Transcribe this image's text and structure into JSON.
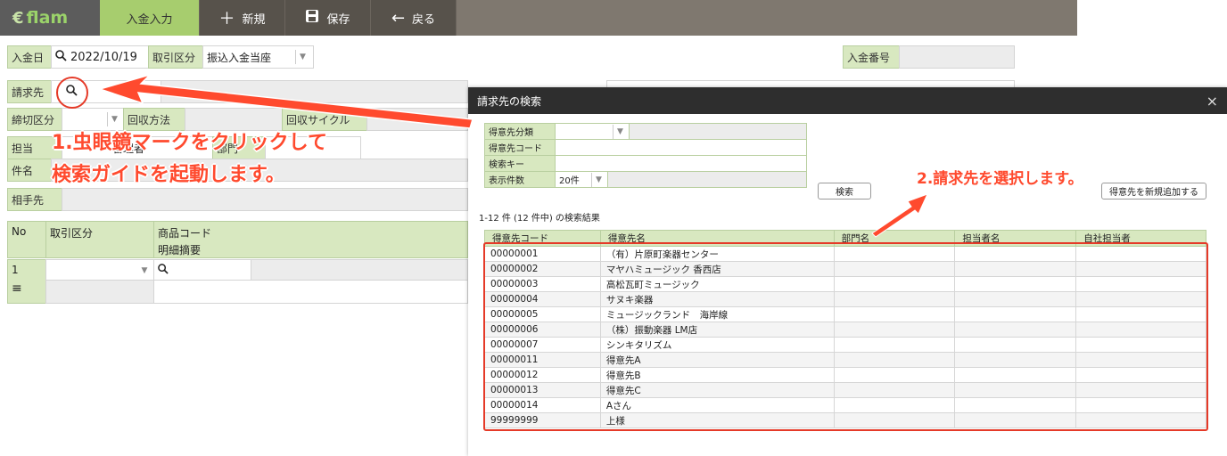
{
  "toolbar": {
    "logo": "flam",
    "active_tab": "入金入力",
    "new_label": "新規",
    "save_label": "保存",
    "back_label": "戻る"
  },
  "form": {
    "deposit_date_label": "入金日",
    "deposit_date_value": "2022/10/19",
    "trade_type_label": "取引区分",
    "trade_type_value": "振込入金当座",
    "deposit_no_label": "入金番号",
    "billing_label": "請求先",
    "cutoff_label": "締切区分",
    "collection_method_label": "回収方法",
    "collection_cycle_label": "回収サイクル",
    "staff_label": "担当",
    "staff_value": "管理者",
    "dept_label": "部門",
    "subject_label": "件名",
    "partner_label": "相手先"
  },
  "grid": {
    "col_no": "No",
    "col_trade": "取引区分",
    "col_product_code": "商品コード",
    "col_detail": "明細摘要",
    "row1_no": "1"
  },
  "modal": {
    "title": "請求先の検索",
    "close": "×",
    "cust_category_label": "得意先分類",
    "cust_code_label": "得意先コード",
    "search_key_label": "検索キー",
    "display_count_label": "表示件数",
    "display_count_value": "20件",
    "search_button": "検索",
    "add_new_button": "得意先を新規追加する",
    "result_count": "1-12 件 (12 件中) の検索結果",
    "columns": [
      "得意先コード",
      "得意先名",
      "部門名",
      "担当者名",
      "自社担当者"
    ],
    "rows": [
      [
        "00000001",
        "（有）片原町楽器センター"
      ],
      [
        "00000002",
        "マヤハミュージック 香西店"
      ],
      [
        "00000003",
        "高松瓦町ミュージック"
      ],
      [
        "00000004",
        "サヌキ楽器"
      ],
      [
        "00000005",
        "ミュージックランド　海岸線"
      ],
      [
        "00000006",
        "（株）振動楽器 LM店"
      ],
      [
        "00000007",
        "シンキタリズム"
      ],
      [
        "00000011",
        "得意先A"
      ],
      [
        "00000012",
        "得意先B"
      ],
      [
        "00000013",
        "得意先C"
      ],
      [
        "00000014",
        "Aさん"
      ],
      [
        "99999999",
        "上様"
      ]
    ]
  },
  "annotations": {
    "step1_line1": "1.虫眼鏡マークをクリックして",
    "step1_line2": "検索ガイドを起動します。",
    "step2": "2.請求先を選択します。"
  },
  "colors": {
    "accent_green": "#a7cd6e",
    "label_green": "#d8e8c0",
    "annotation_red": "#ff4a2e"
  }
}
